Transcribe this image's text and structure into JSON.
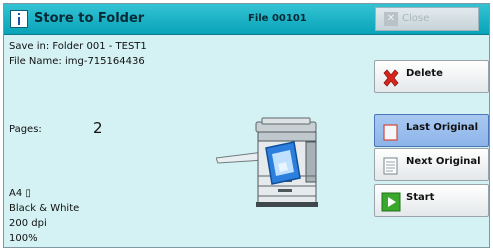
{
  "header": {
    "title": "Store to Folder",
    "file_label": "File 00101",
    "close_label": "Close"
  },
  "info": {
    "save_in": "Save in: Folder 001 - TEST1",
    "file_name": "File Name: img-715164436",
    "pages_label": "Pages:",
    "pages_value": "2",
    "paper_size": "A4 ▯",
    "color_mode": "Black & White",
    "resolution": "200 dpi",
    "scale": "100%"
  },
  "buttons": {
    "delete": "Delete",
    "last_original": "Last Original",
    "next_original": "Next Original",
    "start": "Start"
  },
  "colors": {
    "title_bar": "#08a3b9",
    "panel_bg": "#d4f1f4",
    "selected_button": "#8db4e8",
    "delete_x": "#d8261c",
    "start_green": "#3aa82c"
  }
}
